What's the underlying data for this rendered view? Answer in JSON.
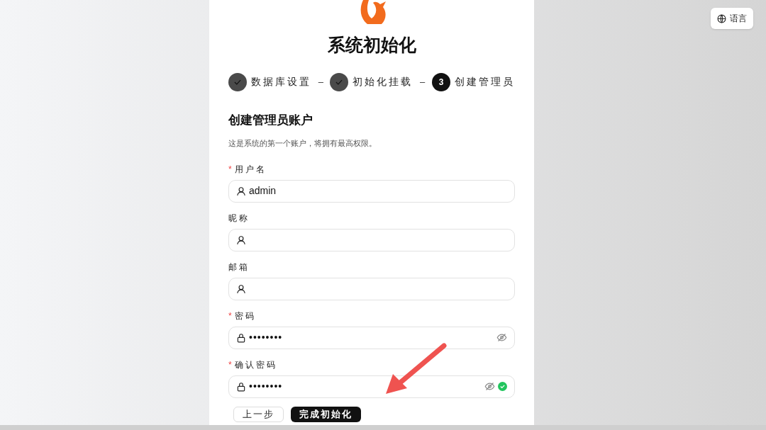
{
  "language_button": {
    "label": "语言"
  },
  "title": "系统初始化",
  "steps": [
    {
      "label": "数据库设置",
      "done": true
    },
    {
      "label": "初始化挂载",
      "done": true
    },
    {
      "label": "创建管理员",
      "done": false,
      "number": "3"
    }
  ],
  "step_separator": "–",
  "section": {
    "heading": "创建管理员账户",
    "description": "这是系统的第一个账户，将拥有最高权限。"
  },
  "fields": [
    {
      "label": "用户名",
      "required": true,
      "kind": "text",
      "value": "admin",
      "valid": false
    },
    {
      "label": "昵称",
      "required": false,
      "kind": "text",
      "valid": false
    },
    {
      "label": "邮箱",
      "required": false,
      "kind": "text",
      "valid": false
    },
    {
      "label": "密码",
      "required": true,
      "kind": "password",
      "value": "••••••••",
      "valid": false
    },
    {
      "label": "确认密码",
      "required": true,
      "kind": "password",
      "value": "••••••••",
      "valid": true
    }
  ],
  "required_mark": "*",
  "buttons": [
    {
      "label": "上一步",
      "kind": "secondary"
    },
    {
      "label": "完成初始化",
      "kind": "primary"
    }
  ]
}
